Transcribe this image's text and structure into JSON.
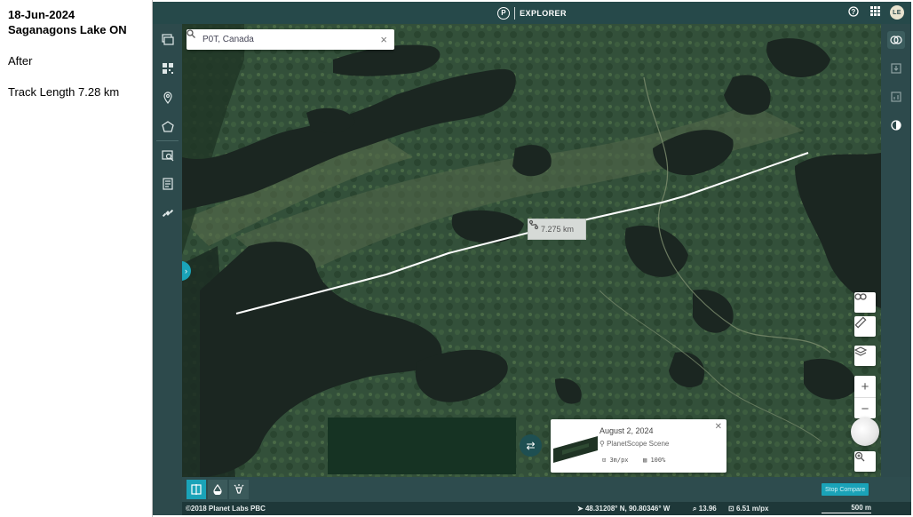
{
  "note": {
    "title": "18-Jun-2024 Saganagons Lake ON",
    "state": "After",
    "track": "Track Length 7.28 km"
  },
  "header": {
    "logo_letter": "P",
    "app_name": "EXPLORER",
    "avatar": "LE",
    "icons": [
      "help-icon",
      "apps-grid-icon"
    ]
  },
  "search": {
    "value": "P0T, Canada"
  },
  "measure": {
    "distance": "7.275 km"
  },
  "scene": {
    "date": "August 2, 2024",
    "type": "PlanetScope Scene",
    "resolution": "3m/px",
    "coverage": "100%"
  },
  "bottom": {
    "stop_compare": "Stop Compare"
  },
  "status": {
    "copyright": "©2018 Planet Labs PBC",
    "coordinates": "48.31208° N, 90.80346° W",
    "zoom": "13.96",
    "resolution": "6.51 m/px",
    "scale": "500 m"
  },
  "colors": {
    "frame": "#2e4c4e",
    "accent": "#1aa3b8",
    "water": "#1b2621",
    "forest": "#2f4a33"
  }
}
